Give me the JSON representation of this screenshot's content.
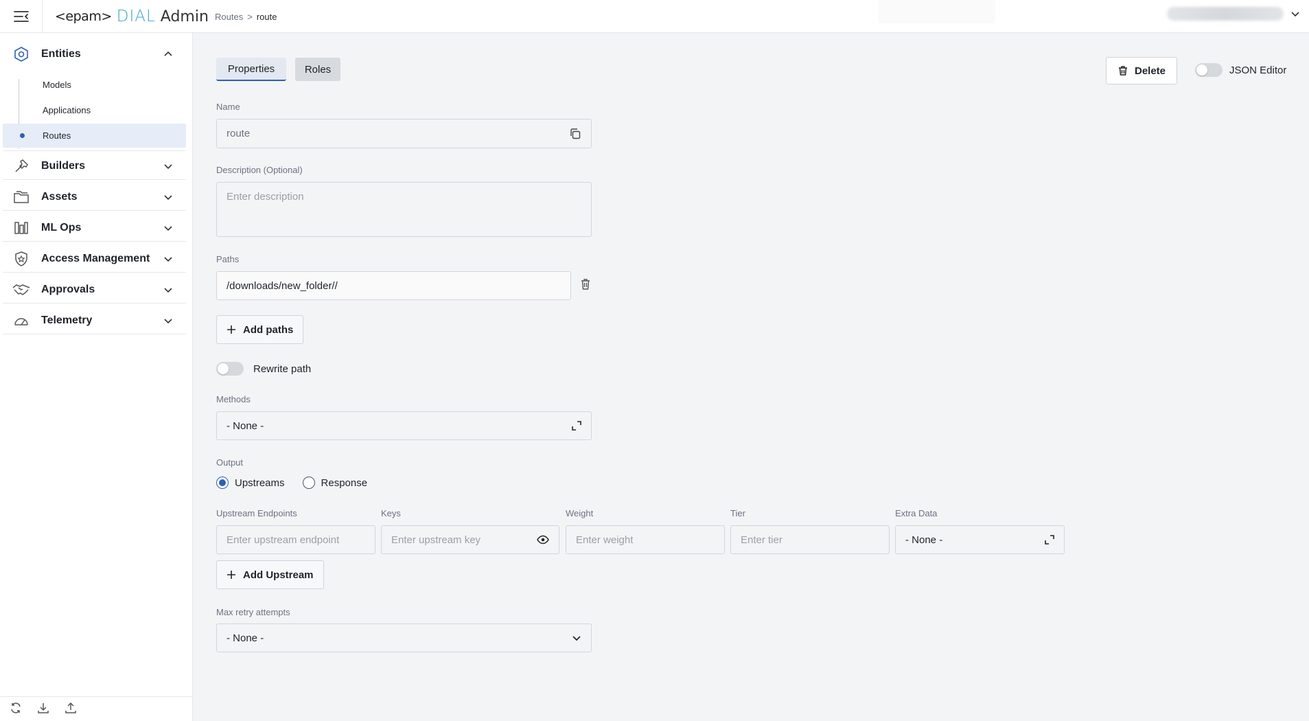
{
  "header": {
    "logo": {
      "epam": "<epam>",
      "dial": "DIAL",
      "admin": "Admin"
    },
    "breadcrumb": {
      "parent": "Routes",
      "separator": ">",
      "current": "route"
    }
  },
  "sidebar": {
    "groups": [
      {
        "label": "Entities",
        "icon": "entities-icon",
        "expanded": true
      },
      {
        "label": "Builders",
        "icon": "hammer-icon"
      },
      {
        "label": "Assets",
        "icon": "folder-icon"
      },
      {
        "label": "ML Ops",
        "icon": "mlops-icon"
      },
      {
        "label": "Access Management",
        "icon": "shield-icon"
      },
      {
        "label": "Approvals",
        "icon": "handshake-icon"
      },
      {
        "label": "Telemetry",
        "icon": "gauge-icon"
      }
    ],
    "entities_items": [
      {
        "label": "Models"
      },
      {
        "label": "Applications"
      },
      {
        "label": "Routes",
        "active": true
      }
    ],
    "bottom_icons": [
      "refresh-icon",
      "download-icon",
      "upload-icon"
    ]
  },
  "tabs": {
    "properties": "Properties",
    "roles": "Roles"
  },
  "toolbar": {
    "delete": "Delete",
    "json_editor": "JSON Editor",
    "json_editor_on": false
  },
  "form": {
    "name": {
      "label": "Name",
      "value": "route"
    },
    "description": {
      "label": "Description (Optional)",
      "placeholder": "Enter description"
    },
    "paths": {
      "label": "Paths",
      "values": [
        "/downloads/new_folder//"
      ],
      "add_label": "Add paths"
    },
    "rewrite_path": {
      "label": "Rewrite path",
      "on": false
    },
    "methods": {
      "label": "Methods",
      "value": "- None -"
    },
    "output": {
      "label": "Output",
      "options": [
        "Upstreams",
        "Response"
      ],
      "selected": "Upstreams"
    },
    "upstreams": {
      "columns": {
        "endpoints": "Upstream Endpoints",
        "keys": "Keys",
        "weight": "Weight",
        "tier": "Tier",
        "extra_data": "Extra Data"
      },
      "placeholders": {
        "endpoint": "Enter upstream endpoint",
        "key": "Enter upstream key",
        "weight": "Enter weight",
        "tier": "Enter tier"
      },
      "extra_data_value": "- None -",
      "add_label": "Add Upstream"
    },
    "max_retry": {
      "label": "Max retry attempts",
      "value": "- None -"
    }
  },
  "colors": {
    "accent": "#2d5fb5",
    "dial_logo": "#3aa3c9",
    "active_bg": "#e6ecf8"
  }
}
